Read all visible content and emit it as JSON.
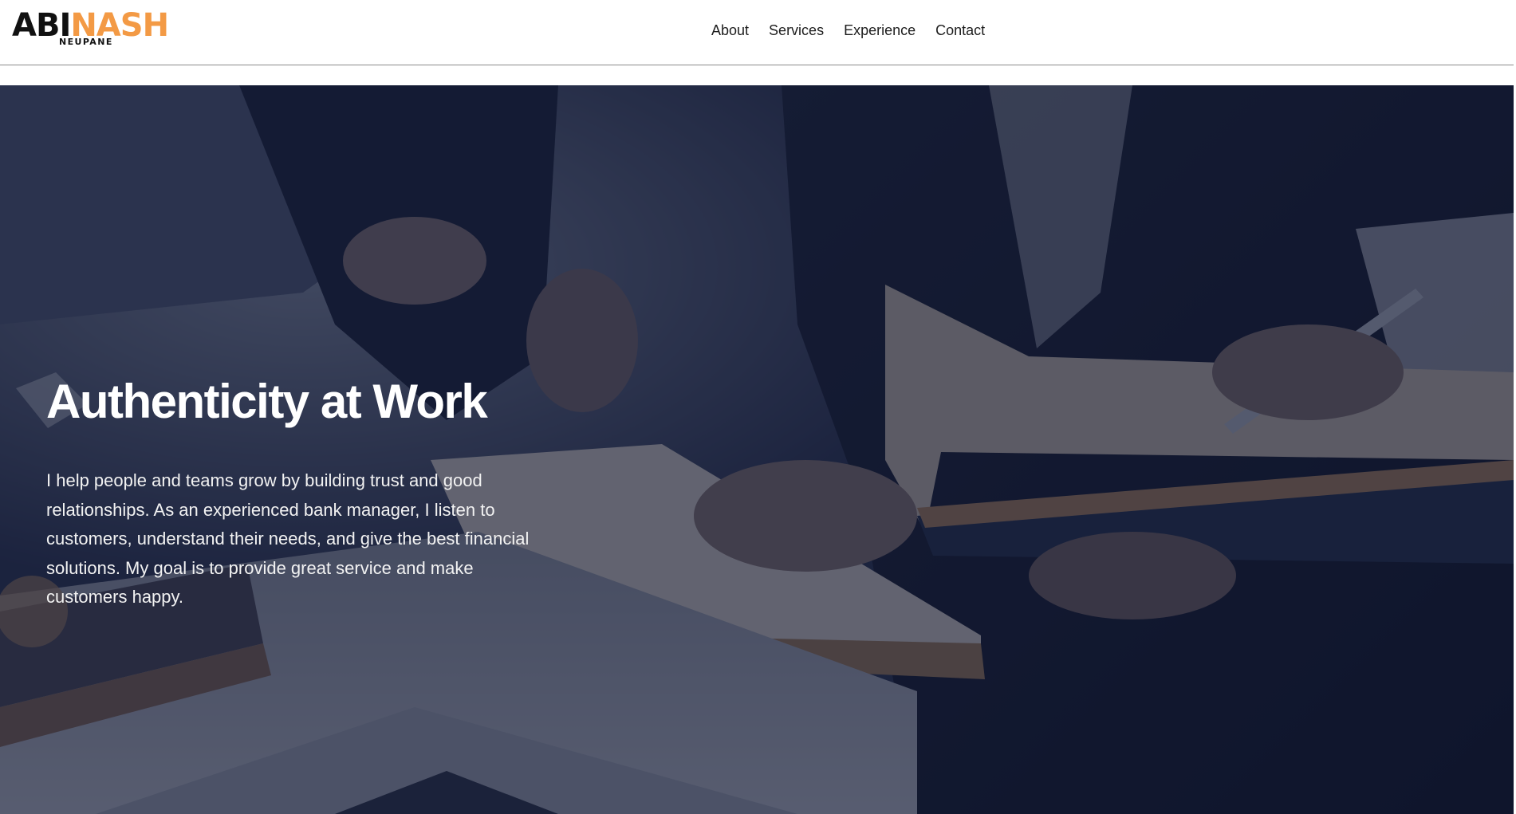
{
  "brand": {
    "logo_part1": "ABI",
    "logo_part2": "NASH",
    "logo_sub": "NEUPANE",
    "accent_color": "#f39a45"
  },
  "nav": {
    "items": [
      {
        "label": "About"
      },
      {
        "label": "Services"
      },
      {
        "label": "Experience"
      },
      {
        "label": "Contact"
      }
    ]
  },
  "hero": {
    "title": "Authenticity at Work",
    "text": "I help people and teams grow by building trust and good relationships. As an experienced bank manager, I listen to customers, understand their needs, and give the best financial solutions. My goal is to provide great service and make customers happy.",
    "overlay_color": "#111834"
  }
}
